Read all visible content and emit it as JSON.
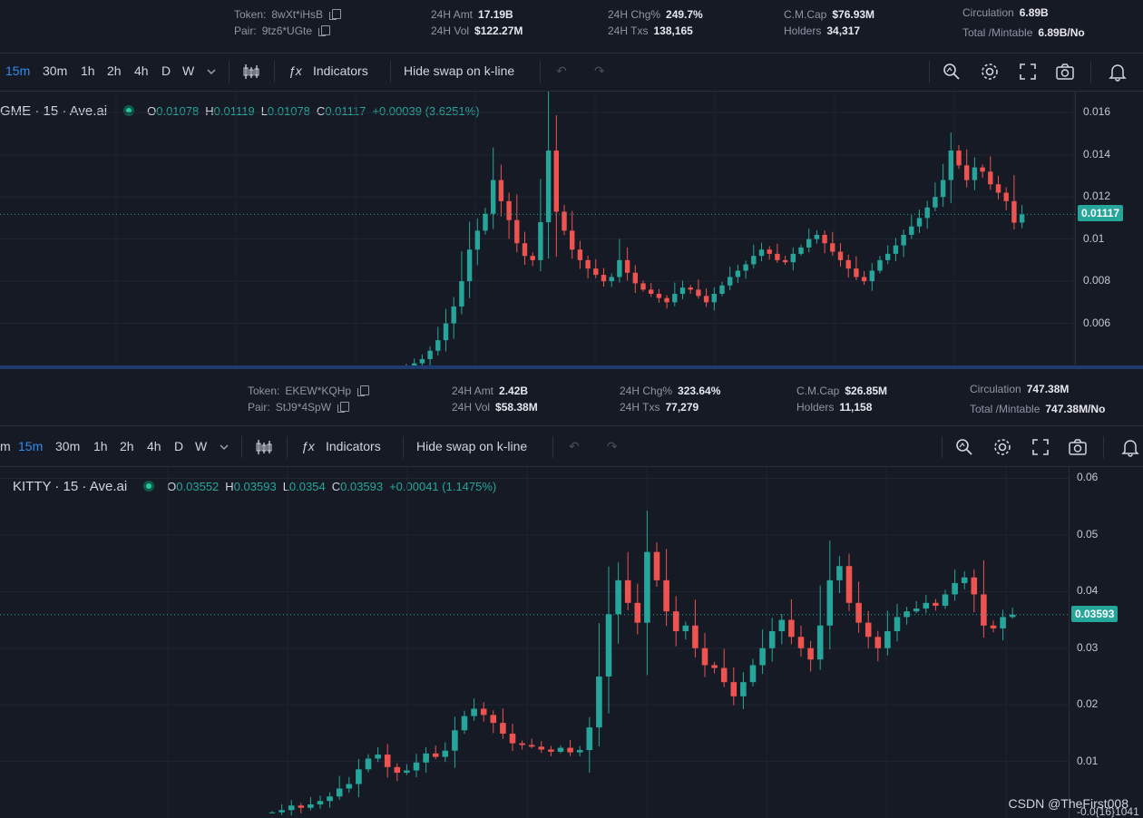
{
  "panels": [
    {
      "stats": {
        "token_label": "Token:",
        "token": "8wXt*iHsB",
        "pair_label": "Pair:",
        "pair": "9tz6*UGte",
        "amt_label": "24H Amt",
        "amt": "17.19B",
        "vol_label": "24H Vol",
        "vol": "$122.27M",
        "chg_label": "24H Chg%",
        "chg": "249.7%",
        "txs_label": "24H Txs",
        "txs": "138,165",
        "cap_label": "C.M.Cap",
        "cap": "$76.93M",
        "holders_label": "Holders",
        "holders": "34,317",
        "circ_label": "Circulation",
        "circ": "6.89B",
        "mint_label": "Total /Mintable",
        "mint": "6.89B/No"
      },
      "toolbar": {
        "intervals": [
          "15m",
          "30m",
          "1h",
          "2h",
          "4h",
          "D",
          "W"
        ],
        "active_interval": "15m",
        "indicators": "Indicators",
        "hide_swap": "Hide swap on k-line"
      },
      "legend": {
        "symbol": "GME · 15 · Ave.ai",
        "o_label": "O",
        "o": "0.01078",
        "h_label": "H",
        "h": "0.01119",
        "l_label": "L",
        "l": "0.01078",
        "c_label": "C",
        "c": "0.01117",
        "change": "+0.00039 (3.6251%)"
      },
      "price_labels": [
        "0.016",
        "0.014",
        "0.012",
        "0.01",
        "0.008",
        "0.006"
      ],
      "last_price": "0.01117"
    },
    {
      "stats": {
        "token_label": "Token:",
        "token": "EKEW*KQHp",
        "pair_label": "Pair:",
        "pair": "StJ9*4SpW",
        "amt_label": "24H Amt",
        "amt": "2.42B",
        "vol_label": "24H Vol",
        "vol": "$58.38M",
        "chg_label": "24H Chg%",
        "chg": "323.64%",
        "txs_label": "24H Txs",
        "txs": "77,279",
        "cap_label": "C.M.Cap",
        "cap": "$26.85M",
        "holders_label": "Holders",
        "holders": "11,158",
        "circ_label": "Circulation",
        "circ": "747.38M",
        "mint_label": "Total /Mintable",
        "mint": "747.38M/No"
      },
      "toolbar": {
        "intervals": [
          "m",
          "15m",
          "30m",
          "1h",
          "2h",
          "4h",
          "D",
          "W"
        ],
        "active_interval": "15m",
        "indicators": "Indicators",
        "hide_swap": "Hide swap on k-line"
      },
      "legend": {
        "symbol": "KITTY · 15 · Ave.ai",
        "o_label": "O",
        "o": "0.03552",
        "h_label": "H",
        "h": "0.03593",
        "l_label": "L",
        "l": "0.0354",
        "c_label": "C",
        "c": "0.03593",
        "change": "+0.00041 (1.1475%)"
      },
      "price_labels": [
        "0.06",
        "0.05",
        "0.04",
        "0.03",
        "0.02",
        "0.01",
        "-0.0{16}1041"
      ],
      "last_price": "0.03593"
    }
  ],
  "watermark": "CSDN @TheFirst008",
  "colors": {
    "up": "#26a69a",
    "down": "#ef5350",
    "accent": "#2f8cf0",
    "background": "#161a25"
  },
  "chart_data": [
    {
      "type": "candlestick",
      "title": "GME · 15 · Ave.ai",
      "ylim": [
        0.004,
        0.017
      ],
      "last": 0.01117,
      "closes": [
        0.004,
        0.0041,
        0.0043,
        0.0047,
        0.0052,
        0.006,
        0.0068,
        0.008,
        0.0095,
        0.0104,
        0.0112,
        0.0128,
        0.0118,
        0.0109,
        0.0098,
        0.0092,
        0.009,
        0.0108,
        0.0142,
        0.0113,
        0.0104,
        0.0095,
        0.009,
        0.0086,
        0.0083,
        0.008,
        0.0082,
        0.009,
        0.0084,
        0.0079,
        0.0076,
        0.0074,
        0.0072,
        0.007,
        0.0074,
        0.0077,
        0.0076,
        0.0073,
        0.007,
        0.0074,
        0.0078,
        0.0082,
        0.0085,
        0.0088,
        0.0092,
        0.0095,
        0.0093,
        0.009,
        0.0089,
        0.0093,
        0.0096,
        0.01,
        0.0102,
        0.0098,
        0.0094,
        0.009,
        0.0086,
        0.0082,
        0.008,
        0.0085,
        0.009,
        0.0093,
        0.0097,
        0.0102,
        0.0106,
        0.011,
        0.0115,
        0.012,
        0.0128,
        0.0142,
        0.0135,
        0.0128,
        0.0134,
        0.0132,
        0.0126,
        0.0122,
        0.0118,
        0.01078,
        0.01117
      ]
    },
    {
      "type": "candlestick",
      "title": "KITTY · 15 · Ave.ai",
      "ylim": [
        0.0,
        0.062
      ],
      "last": 0.03593,
      "closes": [
        0.001,
        0.0014,
        0.0022,
        0.0018,
        0.0024,
        0.003,
        0.0038,
        0.0052,
        0.006,
        0.0086,
        0.0105,
        0.0112,
        0.009,
        0.008,
        0.0084,
        0.0098,
        0.0114,
        0.0108,
        0.0119,
        0.0155,
        0.018,
        0.0193,
        0.0182,
        0.0168,
        0.0149,
        0.0132,
        0.0129,
        0.0126,
        0.0121,
        0.0117,
        0.0124,
        0.0116,
        0.012,
        0.016,
        0.025,
        0.036,
        0.042,
        0.038,
        0.0345,
        0.047,
        0.042,
        0.0365,
        0.033,
        0.034,
        0.03,
        0.027,
        0.0265,
        0.024,
        0.0215,
        0.024,
        0.027,
        0.03,
        0.033,
        0.035,
        0.032,
        0.03,
        0.028,
        0.034,
        0.042,
        0.0445,
        0.038,
        0.0345,
        0.032,
        0.03,
        0.033,
        0.0355,
        0.0365,
        0.037,
        0.038,
        0.0375,
        0.0395,
        0.0415,
        0.0425,
        0.0395,
        0.034,
        0.0335,
        0.0355,
        0.03593
      ]
    }
  ]
}
